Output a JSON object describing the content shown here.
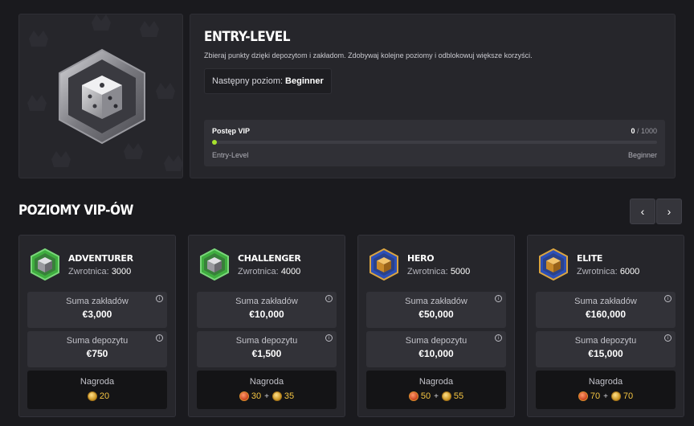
{
  "current_level": {
    "title": "ENTRY-LEVEL",
    "description": "Zbieraj punkty dzięki depozytom i zakładom. Zdobywaj kolejne poziomy i odblokowuj większe korzyści.",
    "next_level_label": "Następny poziom:",
    "next_level_value": "Beginner",
    "badge_icon": "dice-badge-icon"
  },
  "progress": {
    "label": "Postęp VIP",
    "current": "0",
    "total": "/ 1000",
    "fraction": 0.0,
    "from": "Entry-Level",
    "to": "Beginner",
    "fill_color": "#a6e22e"
  },
  "levels_section": {
    "title": "POZIOMY VIP-ÓW",
    "prev_icon": "chevron-left-icon",
    "next_icon": "chevron-right-icon"
  },
  "levels": [
    {
      "name": "ADVENTURER",
      "cashback_label": "Zwrotnica:",
      "cashback_value": "3000",
      "bets_label": "Suma zakładów",
      "bets_value": "€3,000",
      "deposit_label": "Suma depozytu",
      "deposit_value": "€750",
      "reward_label": "Nagroda",
      "reward_red": "",
      "reward_plus": "",
      "reward_gold": "20",
      "badge_color": "#3fae3f"
    },
    {
      "name": "CHALLENGER",
      "cashback_label": "Zwrotnica:",
      "cashback_value": "4000",
      "bets_label": "Suma zakładów",
      "bets_value": "€10,000",
      "deposit_label": "Suma depozytu",
      "deposit_value": "€1,500",
      "reward_label": "Nagroda",
      "reward_red": "30",
      "reward_plus": "+",
      "reward_gold": "35",
      "badge_color": "#3fae3f"
    },
    {
      "name": "HERO",
      "cashback_label": "Zwrotnica:",
      "cashback_value": "5000",
      "bets_label": "Suma zakładów",
      "bets_value": "€50,000",
      "deposit_label": "Suma depozytu",
      "deposit_value": "€10,000",
      "reward_label": "Nagroda",
      "reward_red": "50",
      "reward_plus": "+",
      "reward_gold": "55",
      "badge_color": "#2c4fb8"
    },
    {
      "name": "ELITE",
      "cashback_label": "Zwrotnica:",
      "cashback_value": "6000",
      "bets_label": "Suma zakładów",
      "bets_value": "€160,000",
      "deposit_label": "Suma depozytu",
      "deposit_value": "€15,000",
      "reward_label": "Nagroda",
      "reward_red": "70",
      "reward_plus": "+",
      "reward_gold": "70",
      "badge_color": "#2c4fb8"
    }
  ]
}
